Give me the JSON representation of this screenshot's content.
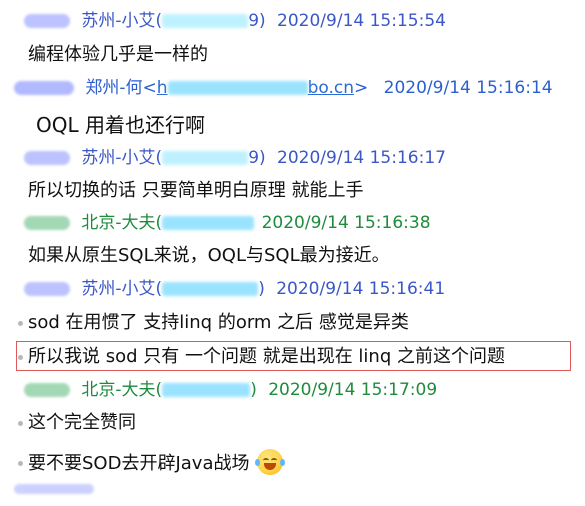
{
  "colors": {
    "suzhou_header": "#3b57c6",
    "zhengzhou_header": "#2b5fd0",
    "beijing_header": "#1f8b3d",
    "link": "#2a6cd4",
    "mask_blue": "#aeb7ff",
    "mask_green": "#9fd6b2",
    "mask_cyan": "#8fe0ff",
    "highlight_border": "#e05a5a"
  },
  "chat": {
    "messages": [
      {
        "sender": "苏州-小艾(",
        "id_visible": "",
        "id_tail": "9)",
        "timestamp": "2020/9/14 15:15:54",
        "text": "编程体验几乎是一样的"
      },
      {
        "sender": "郑州-何<",
        "email_start": "h",
        "email_tail": "bo.cn",
        "email_close": ">",
        "timestamp": "2020/9/14 15:16:14",
        "text": "OQL  用着也还行啊"
      },
      {
        "sender": "苏州-小艾(",
        "id_tail": "9)",
        "timestamp": "2020/9/14 15:16:17",
        "text": "所以切换的话 只要简单明白原理 就能上手"
      },
      {
        "sender": "北京-大夫(",
        "timestamp": "2020/9/14 15:16:38",
        "text": "如果从原生SQL来说，OQL与SQL最为接近。"
      },
      {
        "sender": "苏州-小艾(",
        "id_tail": ")",
        "timestamp": "2020/9/14 15:16:41",
        "text_1": "sod 在用惯了 支持linq 的orm 之后 感觉是异类",
        "text_2": "所以我说 sod 只有 一个问题 就是出现在 linq 之前这个问题"
      },
      {
        "sender": "北京-大夫(",
        "id_tail": ")",
        "timestamp": "2020/9/14 15:17:09",
        "text_1": "这个完全赞同",
        "text_2": "要不要SOD去开辟Java战场"
      }
    ],
    "emoji": "grinning-with-tears-icon"
  }
}
